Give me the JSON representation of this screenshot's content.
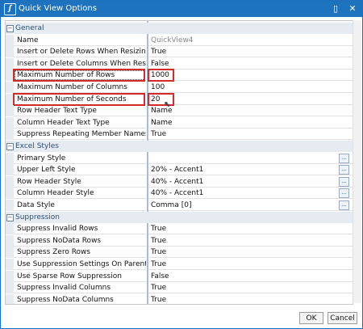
{
  "window": {
    "title": "Quick View Options",
    "icons": {
      "app": "app-logo-icon",
      "clipboard": "clipboard-icon",
      "close": "close-icon"
    }
  },
  "rows": [
    {
      "type": "category",
      "label": "General"
    },
    {
      "type": "prop",
      "label": "Name",
      "value": "QuickView4",
      "dim": true
    },
    {
      "type": "prop",
      "label": "Insert or Delete Rows When Resizing Cube View",
      "value": "True"
    },
    {
      "type": "prop",
      "label": "Insert or Delete Columns When Resizing Cube",
      "value": "False"
    },
    {
      "type": "prop",
      "label": "Maximum Number of Rows",
      "value": "1000",
      "highlight": true,
      "focused": true
    },
    {
      "type": "prop",
      "label": "Maximum Number of Columns",
      "value": "100"
    },
    {
      "type": "prop",
      "label": "Maximum Number of Seconds",
      "value": "20",
      "highlight": true
    },
    {
      "type": "prop",
      "label": "Row Header Text Type",
      "value": "Name"
    },
    {
      "type": "prop",
      "label": "Column Header Text Type",
      "value": "Name"
    },
    {
      "type": "prop",
      "label": "Suppress Repeating Member Names",
      "value": "True"
    },
    {
      "type": "category",
      "label": "Excel Styles"
    },
    {
      "type": "prop",
      "label": "Primary Style",
      "value": "",
      "ellipsis": true
    },
    {
      "type": "prop",
      "label": "Upper Left Style",
      "value": "20% - Accent1",
      "ellipsis": true
    },
    {
      "type": "prop",
      "label": "Row Header Style",
      "value": "40% - Accent1",
      "ellipsis": true
    },
    {
      "type": "prop",
      "label": "Column Header Style",
      "value": "40% - Accent1",
      "ellipsis": true
    },
    {
      "type": "prop",
      "label": "Data Style",
      "value": "Comma [0]",
      "ellipsis": true
    },
    {
      "type": "category",
      "label": "Suppression"
    },
    {
      "type": "prop",
      "label": "Suppress Invalid Rows",
      "value": "True"
    },
    {
      "type": "prop",
      "label": "Suppress NoData Rows",
      "value": "True"
    },
    {
      "type": "prop",
      "label": "Suppress Zero Rows",
      "value": "True"
    },
    {
      "type": "prop",
      "label": "Use Suppression Settings On Parent Rows",
      "value": "True"
    },
    {
      "type": "prop",
      "label": "Use Sparse Row Suppression",
      "value": "False"
    },
    {
      "type": "prop",
      "label": "Suppress Invalid Columns",
      "value": "True"
    },
    {
      "type": "prop",
      "label": "Suppress NoData Columns",
      "value": "True"
    }
  ],
  "footer": {
    "ok": "OK",
    "cancel": "Cancel"
  }
}
